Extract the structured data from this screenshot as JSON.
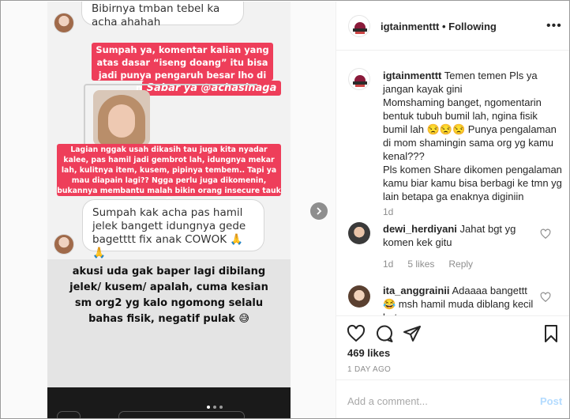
{
  "story": {
    "top_bubble": "Bibirnya tmban tebel ka acha ahahah",
    "pink_1": "Sumpah ya, komentar kalian yang atas dasar “iseng doang” itu bisa jadi punya pengaruh besar lho di mental orang lain.",
    "pink_tag": "Sabar ya @achasinaga",
    "pink_2": "Lagian nggak usah dikasih tau juga kita nyadar kalee, pas hamil jadi gembrot lah, idungnya mekar lah, kulitnya item, kusem, pipinya tembem.. Tapi ya mau diapain lagi?? Ngga perlu juga dikomenin, bukannya membantu malah bikin orang insecure tauk 😫",
    "mid_bubble": "Sumpah kak acha pas hamil jelek bangett idungnya gede bagetttt fix anak COWOK 🙏🙏",
    "caption": "akusi uda gak baper lagi dibilang jelek/ kusem/ apalah, cuma kesian sm org2 yg kalo ngomong selalu bahas fisik, negatif pulak 😅"
  },
  "header": {
    "username": "igtainmenttt",
    "separator": " • ",
    "follow_status": "Following",
    "more_icon": "•••"
  },
  "post_caption": {
    "username": "igtainmenttt",
    "text": "Temen temen Pls ya jangan kayak gini\nMomshaming banget, ngomentarin bentuk tubuh bumil lah, ngina fisik bumil lah 😒😒😒 Punya pengalaman di mom shamingin sama org yg kamu kenal???\nPls komen Share dikomen pengalaman kamu biar kamu bisa berbagi ke tmn yg lain betapa ga enaknya diginiin",
    "time": "1d"
  },
  "comments": [
    {
      "username": "dewi_herdiyani",
      "text": "Jahat bgt yg komen kek gitu",
      "time": "1d",
      "likes": "5 likes",
      "reply": "Reply"
    },
    {
      "username": "ita_anggrainii",
      "text": "Adaaaa bangettt 😂 msh hamil muda diblang kecil bgt"
    }
  ],
  "actions": {
    "likes": "469 likes",
    "time_ago": "1 DAY AGO"
  },
  "add_comment": {
    "placeholder": "Add a comment...",
    "post_label": "Post"
  },
  "colors": {
    "pink": "#ee3e5a",
    "link_disabled": "#b3dbff",
    "muted": "#8e8e8e"
  }
}
